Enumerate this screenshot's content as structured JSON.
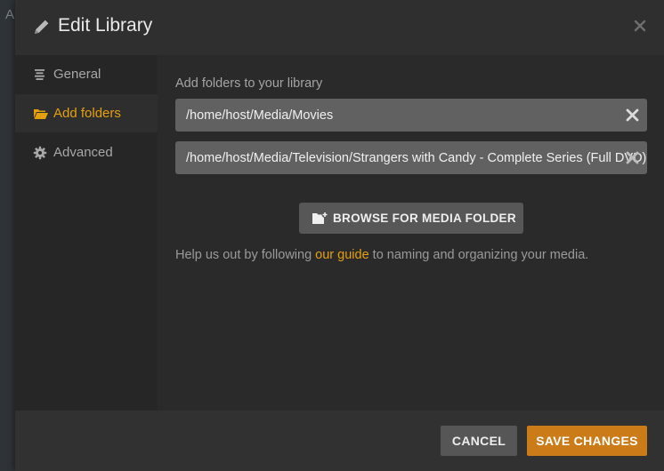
{
  "background": {
    "partial_text": "A"
  },
  "modal": {
    "title": "Edit Library",
    "title_icon": "pencil-icon",
    "close_icon": "close-icon"
  },
  "sidebar": {
    "items": [
      {
        "label": "General",
        "icon": "list-icon",
        "active": false
      },
      {
        "label": "Add folders",
        "icon": "folder-open-icon",
        "active": true
      },
      {
        "label": "Advanced",
        "icon": "gear-icon",
        "active": false
      }
    ]
  },
  "content": {
    "section_label": "Add folders to your library",
    "folders": [
      {
        "path": "/home/host/Media/Movies"
      },
      {
        "path": "/home/host/Media/Television/Strangers with Candy - Complete Series (Full DVD)"
      }
    ],
    "browse_button": {
      "label": "BROWSE FOR MEDIA FOLDER",
      "icon": "add-folder-icon"
    },
    "help": {
      "prefix": "Help us out by following ",
      "link": "our guide",
      "suffix": " to naming and organizing your media."
    }
  },
  "footer": {
    "cancel_label": "CANCEL",
    "save_label": "SAVE CHANGES"
  },
  "colors": {
    "accent": "#e5a00d",
    "save_button": "#cc7b19"
  }
}
